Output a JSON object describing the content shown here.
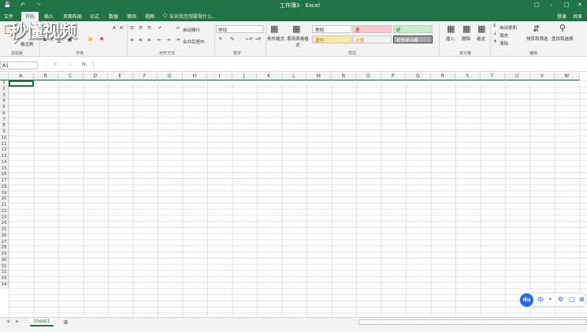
{
  "titlebar": {
    "title": "工作簿3 - Excel",
    "login": "登录",
    "share": "共享"
  },
  "menu": [
    "文件",
    "开始",
    "插入",
    "页面布局",
    "公式",
    "数据",
    "审阅",
    "视图"
  ],
  "search_hint": "告诉我您想要做什么...",
  "watermark": "秒懂视频",
  "ribbon": {
    "clipboard_label": "剪贴板",
    "format_painter": "格式刷",
    "font_label": "字体",
    "align_label": "对齐方式",
    "wrap_text": "自动换行",
    "merge_center": "合并后居中",
    "number_label": "数字",
    "number_format": "常规",
    "conditional_format": "条件格式",
    "table_format": "套用表格格式",
    "styles_label": "样式",
    "style_normal": "常规",
    "style_bad": "差",
    "style_good": "好",
    "style_neutral": "适中",
    "style_calc": "计算",
    "style_check": "检查单元格",
    "insert": "插入",
    "delete": "删除",
    "format": "格式",
    "cells_label": "单元格",
    "autosum": "自动求和",
    "fill": "填充",
    "clear": "清除",
    "sort_filter": "排序和筛选",
    "find_select": "查找和选择",
    "editing_label": "编辑"
  },
  "formula_bar": {
    "name_box": "A1",
    "fx": "fx"
  },
  "columns": [
    "A",
    "B",
    "C",
    "D",
    "E",
    "F",
    "G",
    "H",
    "I",
    "J",
    "K",
    "L",
    "M",
    "N",
    "O",
    "P",
    "Q",
    "R",
    "S",
    "T",
    "U",
    "V",
    "W"
  ],
  "rows": [
    "1",
    "2",
    "3",
    "4",
    "5",
    "6",
    "7",
    "8",
    "9",
    "10",
    "11",
    "12",
    "13",
    "14",
    "15",
    "16",
    "17",
    "18",
    "19",
    "20",
    "21",
    "22",
    "23",
    "24",
    "25",
    "26",
    "27",
    "28",
    "29",
    "30",
    "31",
    "32",
    "33",
    "34"
  ],
  "sheet_tab": "Sheet1",
  "du_toolbar": {
    "logo": "du",
    "lang": "中"
  }
}
